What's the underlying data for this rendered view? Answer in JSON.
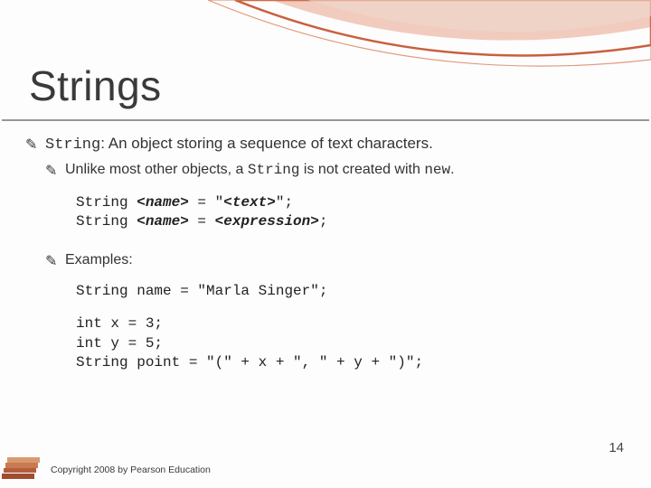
{
  "title": "Strings",
  "bullet_glyph": "✎",
  "line1": {
    "term": "String",
    "rest": ": An object storing a sequence of text characters."
  },
  "line2": {
    "pre": "Unlike most other objects, a ",
    "mid": "String",
    "post1": " is not created with ",
    "kw": "new",
    "post2": "."
  },
  "syntax": {
    "t1a": "String ",
    "t1b": "<name>",
    "t1c": " = \"",
    "t1d": "<text>",
    "t1e": "\";",
    "t2a": "String ",
    "t2b": "<name>",
    "t2c": " = ",
    "t2d": "<expression>",
    "t2e": ";"
  },
  "examples_label": "Examples:",
  "example1": "String name = \"Marla Singer\";",
  "example2": "int x = 3;\nint y = 5;\nString point = \"(\" + x + \", \" + y + \")\";",
  "page_number": "14",
  "copyright": "Copyright 2008 by Pearson Education",
  "chart_data": null
}
